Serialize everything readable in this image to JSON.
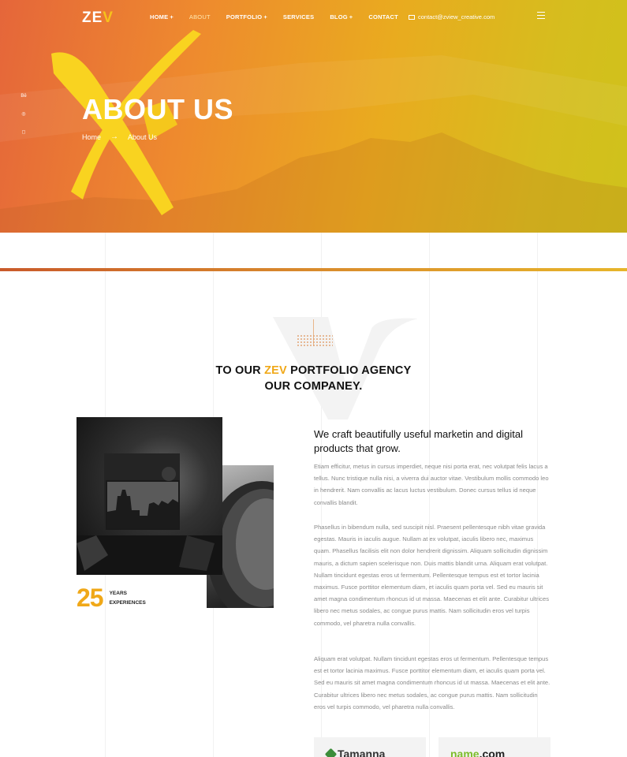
{
  "header": {
    "logo_main": "ZE",
    "logo_accent": "V",
    "nav": [
      {
        "label": "HOME",
        "has_submenu": true,
        "active": false
      },
      {
        "label": "ABOUT",
        "has_submenu": false,
        "active": true
      },
      {
        "label": "PORTFOLIO",
        "has_submenu": true,
        "active": false
      },
      {
        "label": "SERVICES",
        "has_submenu": false,
        "active": false
      },
      {
        "label": "BLOG",
        "has_submenu": true,
        "active": false
      },
      {
        "label": "CONTACT",
        "has_submenu": false,
        "active": false
      }
    ],
    "submenu_marker": "+",
    "email": "contact@zview_creative.com"
  },
  "social": [
    "behance-icon",
    "dribbble-icon",
    "instagram-icon"
  ],
  "social_glyphs": [
    "Bē",
    "◎",
    "◻"
  ],
  "hero": {
    "title": "ABOUT US",
    "breadcrumb_home": "Home",
    "breadcrumb_arrow": "→",
    "breadcrumb_current": "About Us"
  },
  "section": {
    "title_prefix": "TO OUR ",
    "title_accent": "ZEV",
    "title_suffix": " PORTFOLIO AGENCY",
    "title_line2": "OUR COMPANEY."
  },
  "experience": {
    "number": "25",
    "label_line1": "YEARS",
    "label_line2": "EXPERIENCES"
  },
  "content": {
    "lead": "We craft beautifully useful marketin and digital products that grow.",
    "paragraph1": "Etiam efficitur, metus in cursus imperdiet, neque nisi porta erat, nec volutpat felis lacus a tellus. Nunc tristique nulla nisi, a viverra dui auctor vitae. Vestibulum mollis commodo leo in hendrerit. Nam convallis ac lacus luctus vestibulum. Donec cursus tellus id neque convallis blandit.",
    "paragraph2": "Phasellus in bibendum nulla, sed suscipit nisl. Praesent pellentesque nibh vitae gravida egestas. Mauris in iaculis augue. Nullam at ex volutpat, iaculis libero nec, maximus quam. Phasellus facilisis elit non dolor hendrerit dignissim. Aliquam sollicitudin dignissim mauris, a dictum sapien scelerisque non. Duis mattis blandit urna. Aliquam erat volutpat. Nullam tincidunt egestas eros ut fermentum. Pellentesque tempus est et tortor lacinia maximus. Fusce porttitor elementum diam, et iaculis quam porta vel. Sed eu mauris sit amet magna condimentum rhoncus id ut massa. Maecenas et elit ante. Curabitur ultrices libero nec metus sodales, ac congue purus mattis. Nam sollicitudin eros vel turpis commodo, vel pharetra nulla convallis.",
    "paragraph3": "Aliquam erat volutpat. Nullam tincidunt egestas eros ut fermentum. Pellentesque tempus est et tortor lacinia maximus. Fusce porttitor elementum diam, et iaculis quam porta vel. Sed eu mauris sit amet magna condimentum rhoncus id ut massa. Maecenas et elit ante. Curabitur ultrices libero nec metus sodales, ac congue purus mattis. Nam sollicitudin eros vel turpis commodo, vel pharetra nulla convallis."
  },
  "partners": [
    {
      "name": "Tamanna"
    },
    {
      "name_main": "name",
      "name_accent": ".com"
    }
  ],
  "colors": {
    "accent": "#f0a818",
    "hero_gradient_start": "#e5663a",
    "hero_gradient_end": "#cfc21b",
    "partner_green": "#7cbc2a"
  }
}
